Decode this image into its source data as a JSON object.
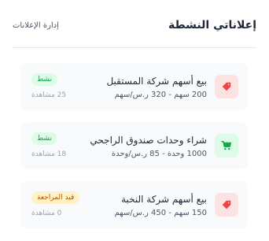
{
  "header": {
    "title": "إعلاناتي النشطة",
    "manage_label": "إدارة الإعلانات"
  },
  "listings": [
    {
      "title": "بيع أسهم شركة المستقبل",
      "details": "200 سهم - 320 ر.س/سهم",
      "status": "نشط",
      "views": "25 مشاهدة",
      "icon": "tag-icon",
      "icon_color": "#ef4444"
    },
    {
      "title": "شراء وحدات صندوق الراجحي",
      "details": "1000 وحدة - 85 ر.س/وحدة",
      "status": "نشط",
      "views": "18 مشاهدة",
      "icon": "cart-icon",
      "icon_color": "#16a34a"
    },
    {
      "title": "بيع أسهم شركة النخبة",
      "details": "150 سهم - 450 ر.س/سهم",
      "status": "قيد المراجعة",
      "views": "0 مشاهدة",
      "icon": "tag-icon",
      "icon_color": "#ef4444"
    }
  ]
}
